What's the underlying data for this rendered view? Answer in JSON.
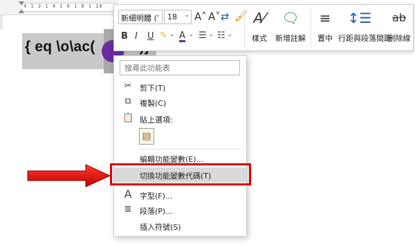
{
  "ruler": {
    "marks": "4 1 2 1 4 1 6 1 8 1 10"
  },
  "document": {
    "field_code": "{  eq \\o\\ac(",
    "field_tail": "1)}",
    "paragraph_mark": "↵"
  },
  "mini_toolbar": {
    "font_name": "新細明體 (",
    "font_size": "18",
    "grow_font": "A˄",
    "shrink_font": "A˅",
    "bold": "B",
    "italic": "I",
    "underline": "U",
    "font_color": "A",
    "styles_label": "樣式",
    "new_comment_label": "新增註解",
    "center_label": "置中",
    "line_spacing_label": "行距與段落間距",
    "strikethrough_label": "刪除線",
    "strikethrough_icon_text": "ab"
  },
  "context_menu": {
    "search_placeholder": "搜尋此功能表",
    "items": [
      {
        "label": "剪下(T)",
        "icon": "scissors-icon"
      },
      {
        "label": "複製(C)",
        "icon": "copy-icon"
      },
      {
        "label": "貼上選項:",
        "icon": "paste-icon"
      },
      {
        "label": "編輯功能變數(E)...",
        "icon": ""
      },
      {
        "label": "切換功能變數代碼(T)",
        "icon": ""
      },
      {
        "label": "字型(F)...",
        "icon": "font-icon"
      },
      {
        "label": "段落(P)...",
        "icon": "paragraph-icon"
      },
      {
        "label": "插入符號(S)",
        "icon": ""
      }
    ],
    "highlighted_item": "切換功能變數代碼(T)"
  },
  "colors": {
    "annotation_red": "#e00000",
    "highlight_font": "#6a2ca0",
    "field_shading": "#c9c9c9"
  }
}
